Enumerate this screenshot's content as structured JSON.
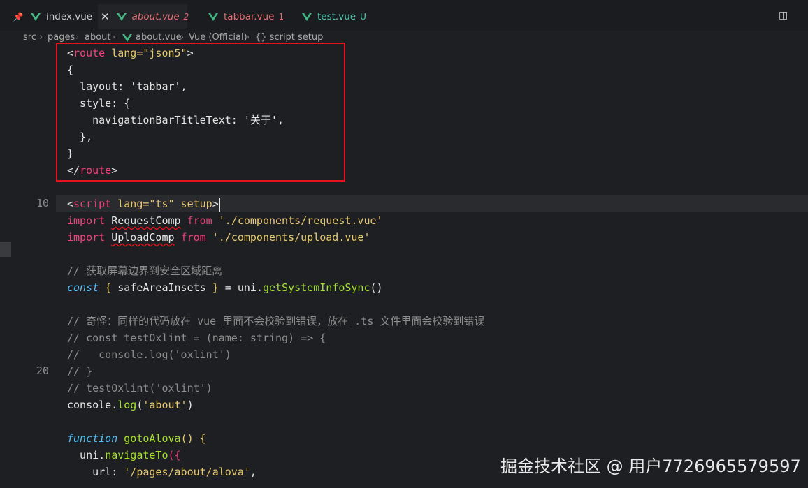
{
  "tabs": [
    {
      "label": "index.vue",
      "pin_icon": "pin-icon",
      "badge": ""
    },
    {
      "label": "about.vue",
      "close_icon": "close-icon",
      "badge": "2",
      "italic": true,
      "color": "#e06c75"
    },
    {
      "label": "tabbar.vue",
      "badge": "1",
      "color": "#e06c75"
    },
    {
      "label": "test.vue",
      "badge": "U",
      "color": "#4ec9b0"
    }
  ],
  "breadcrumb": [
    "src",
    "pages",
    "about",
    "about.vue",
    "Vue (Official)",
    "{} script setup"
  ],
  "line_numbers": {
    "l10": "10",
    "l20": "20"
  },
  "code": {
    "l1a": "<",
    "l1b": "route",
    "l1c": " lang=",
    "l1d": "\"json5\"",
    "l1e": ">",
    "l2": "{",
    "l3": "  layout: 'tabbar',",
    "l4": "  style: {",
    "l5": "    navigationBarTitleText: '关于',",
    "l6": "  },",
    "l7": "}",
    "l8a": "</",
    "l8b": "route",
    "l8c": ">",
    "l10a": "<",
    "l10b": "script",
    "l10c": " lang=",
    "l10d": "\"ts\"",
    "l10e": " setup",
    ">": ">",
    "l11a": "import",
    "l11b": "RequestComp",
    "l11c": "from",
    "l11d": "'./components/request.vue'",
    "l12a": "import",
    "l12b": "UploadComp",
    "l12c": "from",
    "l12d": "'./components/upload.vue'",
    "l14": "// 获取屏幕边界到安全区域距离",
    "l15a": "const",
    "l15b": "{",
    "l15c": " safeAreaInsets ",
    "l15d": "}",
    "l15e": " = uni.",
    "l15f": "getSystemInfoSync",
    "l15g": "()",
    "l17": "// 奇怪：同样的代码放在 vue 里面不会校验到错误，放在 .ts 文件里面会校验到错误",
    "l18": "// const testOxlint = (name: string) => {",
    "l19": "//   console.log('oxlint')",
    "l20": "// }",
    "l21": "// testOxlint('oxlint')",
    "l22a": "console.",
    "l22b": "log",
    "l22c": "(",
    "l22d": "'about'",
    "l22e": ")",
    "l24a": "function",
    "l24b": " gotoAlova",
    "l24c": "() {",
    "l25a": "  uni.",
    "l25b": "navigateTo",
    "l25c": "({",
    "l26a": "    url: ",
    "l26b": "'/pages/about/alova'",
    ",": ","
  },
  "watermark": "掘金技术社区 @ 用户7726965579597",
  "colors": {
    "annotation_box": "#e5131e",
    "tag": "#f0407a",
    "string": "#e6c86e",
    "function": "#a6e22e"
  }
}
